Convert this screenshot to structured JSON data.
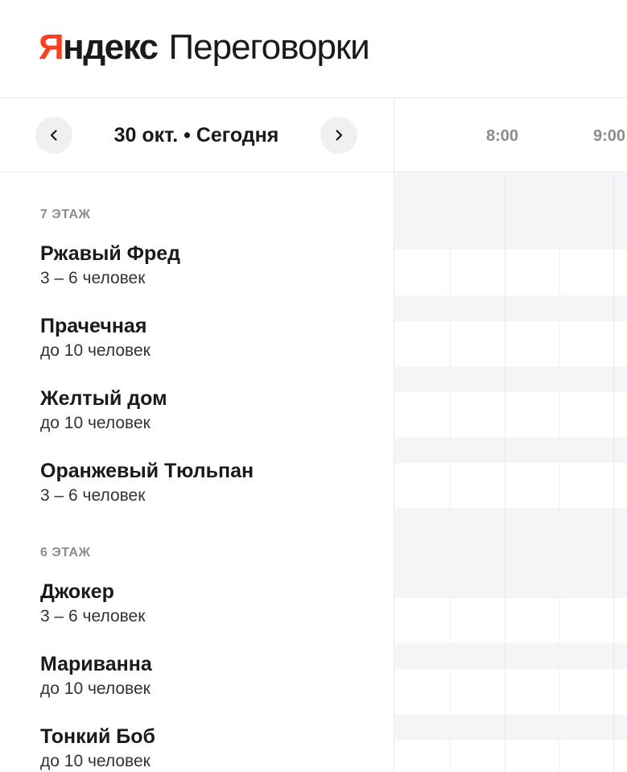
{
  "header": {
    "brand_first_letter": "Я",
    "brand_rest": "ндекс",
    "product": "Переговорки"
  },
  "date_nav": {
    "prev_icon": "chevron-left-icon",
    "date_label": "30 окт. • Сегодня",
    "next_icon": "chevron-right-icon"
  },
  "timeline": {
    "hours": [
      "8:00",
      "9:00"
    ]
  },
  "floors": [
    {
      "label": "7 ЭТАЖ",
      "rooms": [
        {
          "name": "Ржавый Фред",
          "capacity": "3 – 6 человек"
        },
        {
          "name": "Прачечная",
          "capacity": "до 10 человек"
        },
        {
          "name": "Желтый дом",
          "capacity": "до 10 человек"
        },
        {
          "name": "Оранжевый Тюльпан",
          "capacity": "3 – 6 человек"
        }
      ]
    },
    {
      "label": "6 ЭТАЖ",
      "rooms": [
        {
          "name": "Джокер",
          "capacity": "3 – 6 человек"
        },
        {
          "name": "Мариванна",
          "capacity": "до 10 человек"
        },
        {
          "name": "Тонкий Боб",
          "capacity": "до 10 человек"
        }
      ]
    }
  ],
  "colors": {
    "brand_red": "#fc3f1d",
    "text": "#1a1a1a",
    "muted": "#8c8c8c",
    "band": "#f4f5f7",
    "border": "#e6e6e6"
  }
}
